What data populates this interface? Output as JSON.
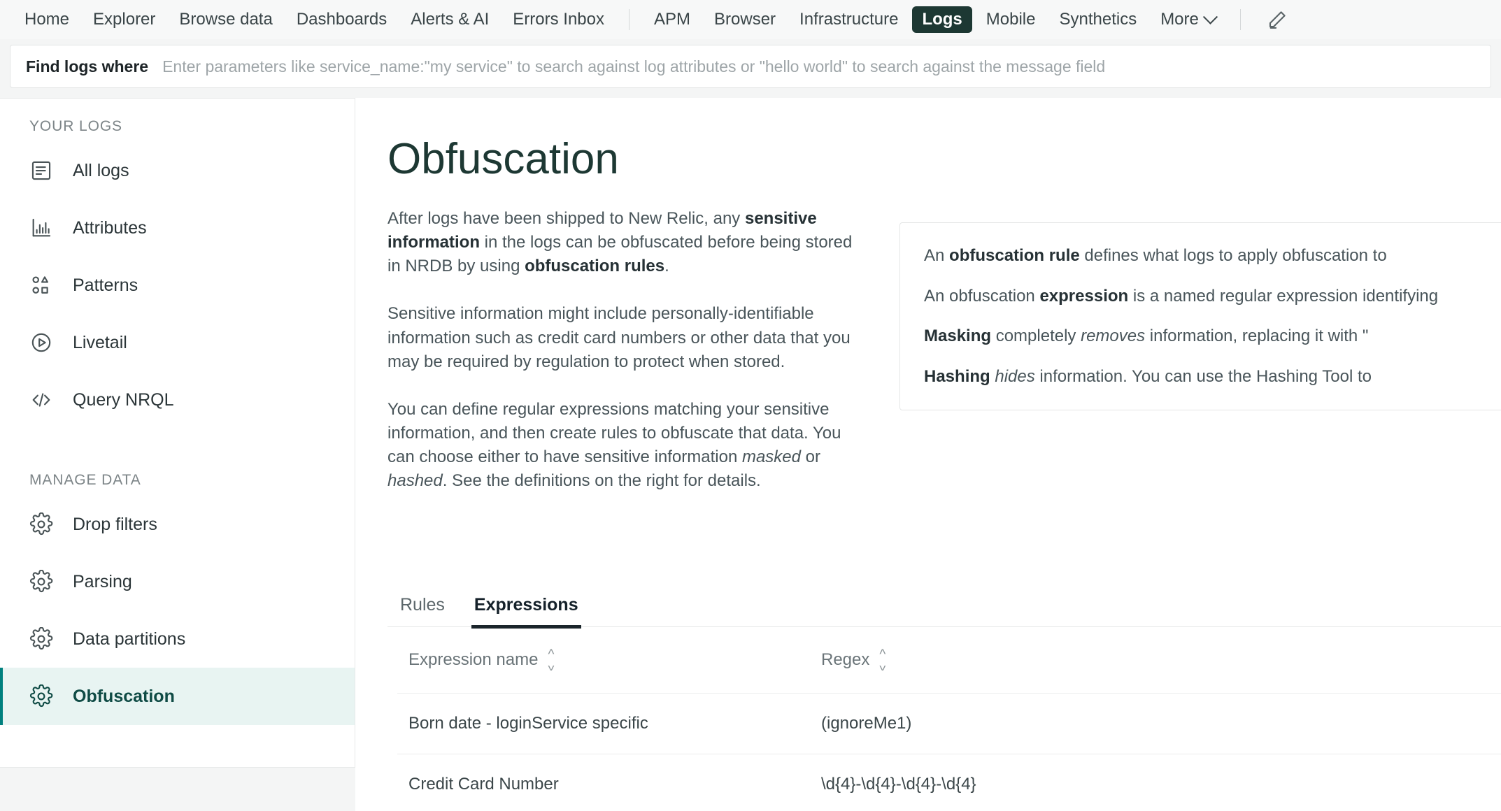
{
  "topnav": {
    "left_items": [
      {
        "label": "Home",
        "icon": "home-icon",
        "active": false
      },
      {
        "label": "Explorer",
        "icon": "explorer-icon",
        "active": false
      },
      {
        "label": "Browse data",
        "icon": "browse-data-icon",
        "active": false
      },
      {
        "label": "Dashboards",
        "icon": "dashboards-icon",
        "active": false
      },
      {
        "label": "Alerts & AI",
        "icon": "alerts-icon",
        "active": false
      },
      {
        "label": "Errors Inbox",
        "icon": "errors-inbox-icon",
        "active": false
      }
    ],
    "right_items": [
      {
        "label": "APM",
        "active": false
      },
      {
        "label": "Browser",
        "active": false
      },
      {
        "label": "Infrastructure",
        "active": false
      },
      {
        "label": "Logs",
        "active": true
      },
      {
        "label": "Mobile",
        "active": false
      },
      {
        "label": "Synthetics",
        "active": false
      }
    ],
    "more_label": "More",
    "more_icon": "chevron-down-icon",
    "edit_icon": "pencil-icon",
    "active_pill_color": "#1d3833"
  },
  "search": {
    "label": "Find logs where",
    "value": "",
    "placeholder": "Enter parameters like service_name:\"my service\" to search against log attributes or \"hello world\" to search against the message field"
  },
  "sidebar": {
    "sections": [
      {
        "title": "YOUR LOGS",
        "items": [
          {
            "label": "All logs",
            "icon": "document-lines-icon",
            "selected": false
          },
          {
            "label": "Attributes",
            "icon": "bar-chart-icon",
            "selected": false
          },
          {
            "label": "Patterns",
            "icon": "shapes-grid-icon",
            "selected": false
          },
          {
            "label": "Livetail",
            "icon": "play-circle-icon",
            "selected": false
          },
          {
            "label": "Query NRQL",
            "icon": "code-brackets-icon",
            "selected": false
          }
        ]
      },
      {
        "title": "MANAGE DATA",
        "items": [
          {
            "label": "Drop filters",
            "icon": "gear-icon",
            "selected": false
          },
          {
            "label": "Parsing",
            "icon": "gear-icon",
            "selected": false
          },
          {
            "label": "Data partitions",
            "icon": "gear-icon",
            "selected": false
          },
          {
            "label": "Obfuscation",
            "icon": "gear-icon",
            "selected": true
          }
        ]
      }
    ],
    "selected_bg": "#e8f4f2",
    "selected_text": "#0f4b45"
  },
  "main": {
    "title": "Obfuscation",
    "paragraphs": [
      {
        "parts": [
          {
            "t": "After logs have been shipped to New Relic, any ",
            "s": "normal"
          },
          {
            "t": "sensitive information",
            "s": "bold"
          },
          {
            "t": " in the logs can be obfuscated before being stored in NRDB by using ",
            "s": "normal"
          },
          {
            "t": "obfuscation rules",
            "s": "bold"
          },
          {
            "t": ".",
            "s": "normal"
          }
        ]
      },
      {
        "parts": [
          {
            "t": "Sensitive information might include personally-identifiable information such as credit card numbers or other data that you may be required by regulation to protect when stored.",
            "s": "normal"
          }
        ]
      },
      {
        "parts": [
          {
            "t": "You can define regular expressions matching your sensitive information, and then create rules to obfuscate that data. You can choose either to have sensitive information ",
            "s": "normal"
          },
          {
            "t": "masked",
            "s": "italic"
          },
          {
            "t": " or ",
            "s": "normal"
          },
          {
            "t": "hashed",
            "s": "italic"
          },
          {
            "t": ". See the definitions on the right for details.",
            "s": "normal"
          }
        ]
      }
    ],
    "definitions_card": {
      "lines": [
        {
          "parts": [
            {
              "t": "An ",
              "s": "normal"
            },
            {
              "t": "obfuscation rule",
              "s": "bold"
            },
            {
              "t": " defines what logs to apply obfuscation to",
              "s": "normal"
            }
          ]
        },
        {
          "parts": [
            {
              "t": "An obfuscation ",
              "s": "normal"
            },
            {
              "t": "expression",
              "s": "bold"
            },
            {
              "t": " is a named regular expression identifying",
              "s": "normal"
            }
          ]
        },
        {
          "parts": [
            {
              "t": "Masking",
              "s": "bold"
            },
            {
              "t": " completely ",
              "s": "normal"
            },
            {
              "t": "removes",
              "s": "italic"
            },
            {
              "t": " information, replacing it with \"",
              "s": "normal"
            }
          ]
        },
        {
          "parts": [
            {
              "t": "Hashing",
              "s": "bold"
            },
            {
              "t": " ",
              "s": "normal"
            },
            {
              "t": "hides",
              "s": "italic"
            },
            {
              "t": " information. You can use the Hashing Tool to",
              "s": "normal"
            }
          ]
        }
      ]
    },
    "tabs": [
      {
        "label": "Rules",
        "active": false
      },
      {
        "label": "Expressions",
        "active": true
      }
    ],
    "table": {
      "columns": [
        {
          "label": "Expression name",
          "sortable": true,
          "sort_icon": "sort-arrows-icon"
        },
        {
          "label": "Regex",
          "sortable": true,
          "sort_icon": "sort-arrows-icon"
        }
      ],
      "rows": [
        {
          "name": "Born date - loginService specific",
          "regex": "(ignoreMe1)"
        },
        {
          "name": "Credit Card Number",
          "regex": "\\d{4}-\\d{4}-\\d{4}-\\d{4}"
        }
      ]
    }
  }
}
